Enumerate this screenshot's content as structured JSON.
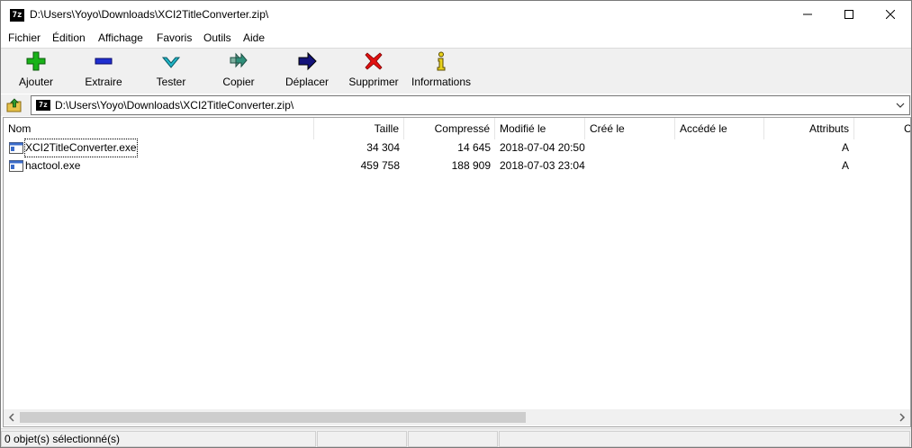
{
  "window": {
    "title": "D:\\Users\\Yoyo\\Downloads\\XCI2TitleConverter.zip\\",
    "app_icon_text": "7z"
  },
  "menu": [
    "Fichier",
    "Édition",
    "Affichage",
    "Favoris",
    "Outils",
    "Aide"
  ],
  "toolbar": {
    "add": "Ajouter",
    "extract": "Extraire",
    "test": "Tester",
    "copy": "Copier",
    "move": "Déplacer",
    "delete": "Supprimer",
    "info": "Informations"
  },
  "address": {
    "path": "D:\\Users\\Yoyo\\Downloads\\XCI2TitleConverter.zip\\",
    "zip_icon_text": "7z"
  },
  "columns": {
    "name": "Nom",
    "size": "Taille",
    "packed": "Compressé",
    "modified": "Modifié le",
    "created": "Créé le",
    "accessed": "Accédé le",
    "attributes": "Attributs",
    "extra": "C"
  },
  "files": [
    {
      "name": "XCI2TitleConverter.exe",
      "size": "34 304",
      "packed": "14 645",
      "modified": "2018-07-04 20:50",
      "created": "",
      "accessed": "",
      "attributes": "A"
    },
    {
      "name": "hactool.exe",
      "size": "459 758",
      "packed": "188 909",
      "modified": "2018-07-03 23:04",
      "created": "",
      "accessed": "",
      "attributes": "A"
    }
  ],
  "status": {
    "selection": "0 objet(s) sélectionné(s)"
  },
  "colors": {
    "add_icon": "#19b319",
    "extract_icon": "#1f2fd1",
    "test_icon": "#1fb6c7",
    "copy_icon": "#2f8f7a",
    "move_icon": "#14137a",
    "delete_icon": "#e01010",
    "info_icon": "#e8d21c",
    "scrollbar_thumb": "#cdcdcd"
  }
}
